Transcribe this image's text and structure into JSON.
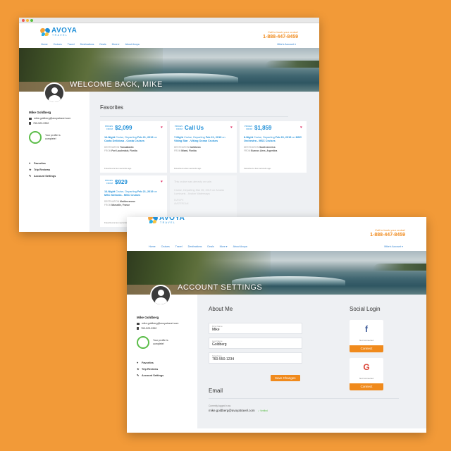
{
  "colors": {
    "background": "#f29a38",
    "brand_blue": "#1f8fd8",
    "accent_orange": "#f08a1c",
    "heart": "#e23b6e",
    "progress_green": "#5cbd4a"
  },
  "brand": {
    "name": "AVOYA",
    "sub": "TRAVEL"
  },
  "call": {
    "label": "Call to book your cruise!",
    "phone": "1-888-447-8459"
  },
  "nav": {
    "items": [
      "Home",
      "Cruises",
      "Travel",
      "Destinations",
      "Deals",
      "More ▾",
      "About Avoya"
    ],
    "account": "Mike's Account ▾"
  },
  "user": {
    "name": "Mike Goldberg",
    "email": "mike.goldberg@avoyatravel.com",
    "phone": "760-523-9352",
    "profile_status": "Your profile is complete!",
    "profile_completion": 1.0
  },
  "side_links": [
    {
      "icon": "heart-icon",
      "label": "Favorites"
    },
    {
      "icon": "star-icon",
      "label": "Trip Reviews"
    },
    {
      "icon": "wrench-icon",
      "label": "Account Settings"
    }
  ],
  "window1": {
    "hero_title": "WELCOME BACK, MIKE",
    "section_title": "Favorites",
    "price_prefix_top": "PRICES",
    "price_prefix_bottom": "FROM",
    "cards": [
      {
        "price": "$2,099",
        "nights": "14-Night",
        "text_a": " Cruise, Departing ",
        "date": "Feb 21, 2019",
        "text_b": " on ",
        "ship": "Costa Deliziosa - Costa Cruises",
        "dest_label": "Destination",
        "dest": "Transatlantic",
        "from_label": "From",
        "from": "Fort Lauderdale, Florida",
        "foot": "Favorited a few seconds ago"
      },
      {
        "price": "Call Us",
        "nights": "7-Night",
        "text_a": " Cruise, Departing ",
        "date": "Feb 21, 2019",
        "text_b": " on ",
        "ship": "Viking Star - Viking Ocean Cruises",
        "dest_label": "Destination",
        "dest": "Caribbean",
        "from_label": "From",
        "from": "Miami, Florida",
        "foot": "Favorited a few seconds ago"
      },
      {
        "price": "$1,859",
        "nights": "8-Night",
        "text_a": " Cruise, Departing ",
        "date": "Feb 20, 2019",
        "text_b": " on ",
        "ship": "MSC Orchestra - MSC Cruises",
        "dest_label": "Destination",
        "dest": "South America",
        "from_label": "From",
        "from": "Buenos Aires, Argentina",
        "foot": "Favorited a few seconds ago"
      },
      {
        "price": "$929",
        "nights": "14-Night",
        "text_a": " Cruise, Departing ",
        "date": "Feb 21, 2019",
        "text_b": " on ",
        "ship": "MSC Sinfonia - MSC Cruises",
        "dest_label": "Destination",
        "dest": "Mediterranean",
        "from_label": "From",
        "from": "Marseille, France",
        "foot": "Favorited a few seconds ago"
      }
    ],
    "faded_card": {
      "line1": "This cruise was already on sale.",
      "line2": "Cruise, Departing Mar 05, 2019 on Amalia Luminaris - Avalon Waterways",
      "line3": "Europe",
      "line4": "Amsterdam"
    }
  },
  "window2": {
    "hero_title": "ACCOUNT SETTINGS",
    "about_title": "About Me",
    "fields": [
      {
        "label": "First Name",
        "value": "Mike"
      },
      {
        "label": "Last Name",
        "value": "Goldberg"
      },
      {
        "label": "Telephone",
        "value": "760-550-1234"
      }
    ],
    "save_label": "Save Changes",
    "email_title": "Email",
    "email_label": "Currently logged in as:",
    "email_value": "mike.goldberg@avoyatravel.com",
    "verified": "✓ Verified",
    "social_title": "Social Login",
    "social": [
      {
        "icon": "facebook-icon",
        "glyph": "f",
        "color": "#3b5998",
        "status": "Not Connected",
        "button": "Connect"
      },
      {
        "icon": "google-icon",
        "glyph": "G",
        "color": "#db4437",
        "status": "Not Connected",
        "button": "Connect"
      }
    ]
  }
}
